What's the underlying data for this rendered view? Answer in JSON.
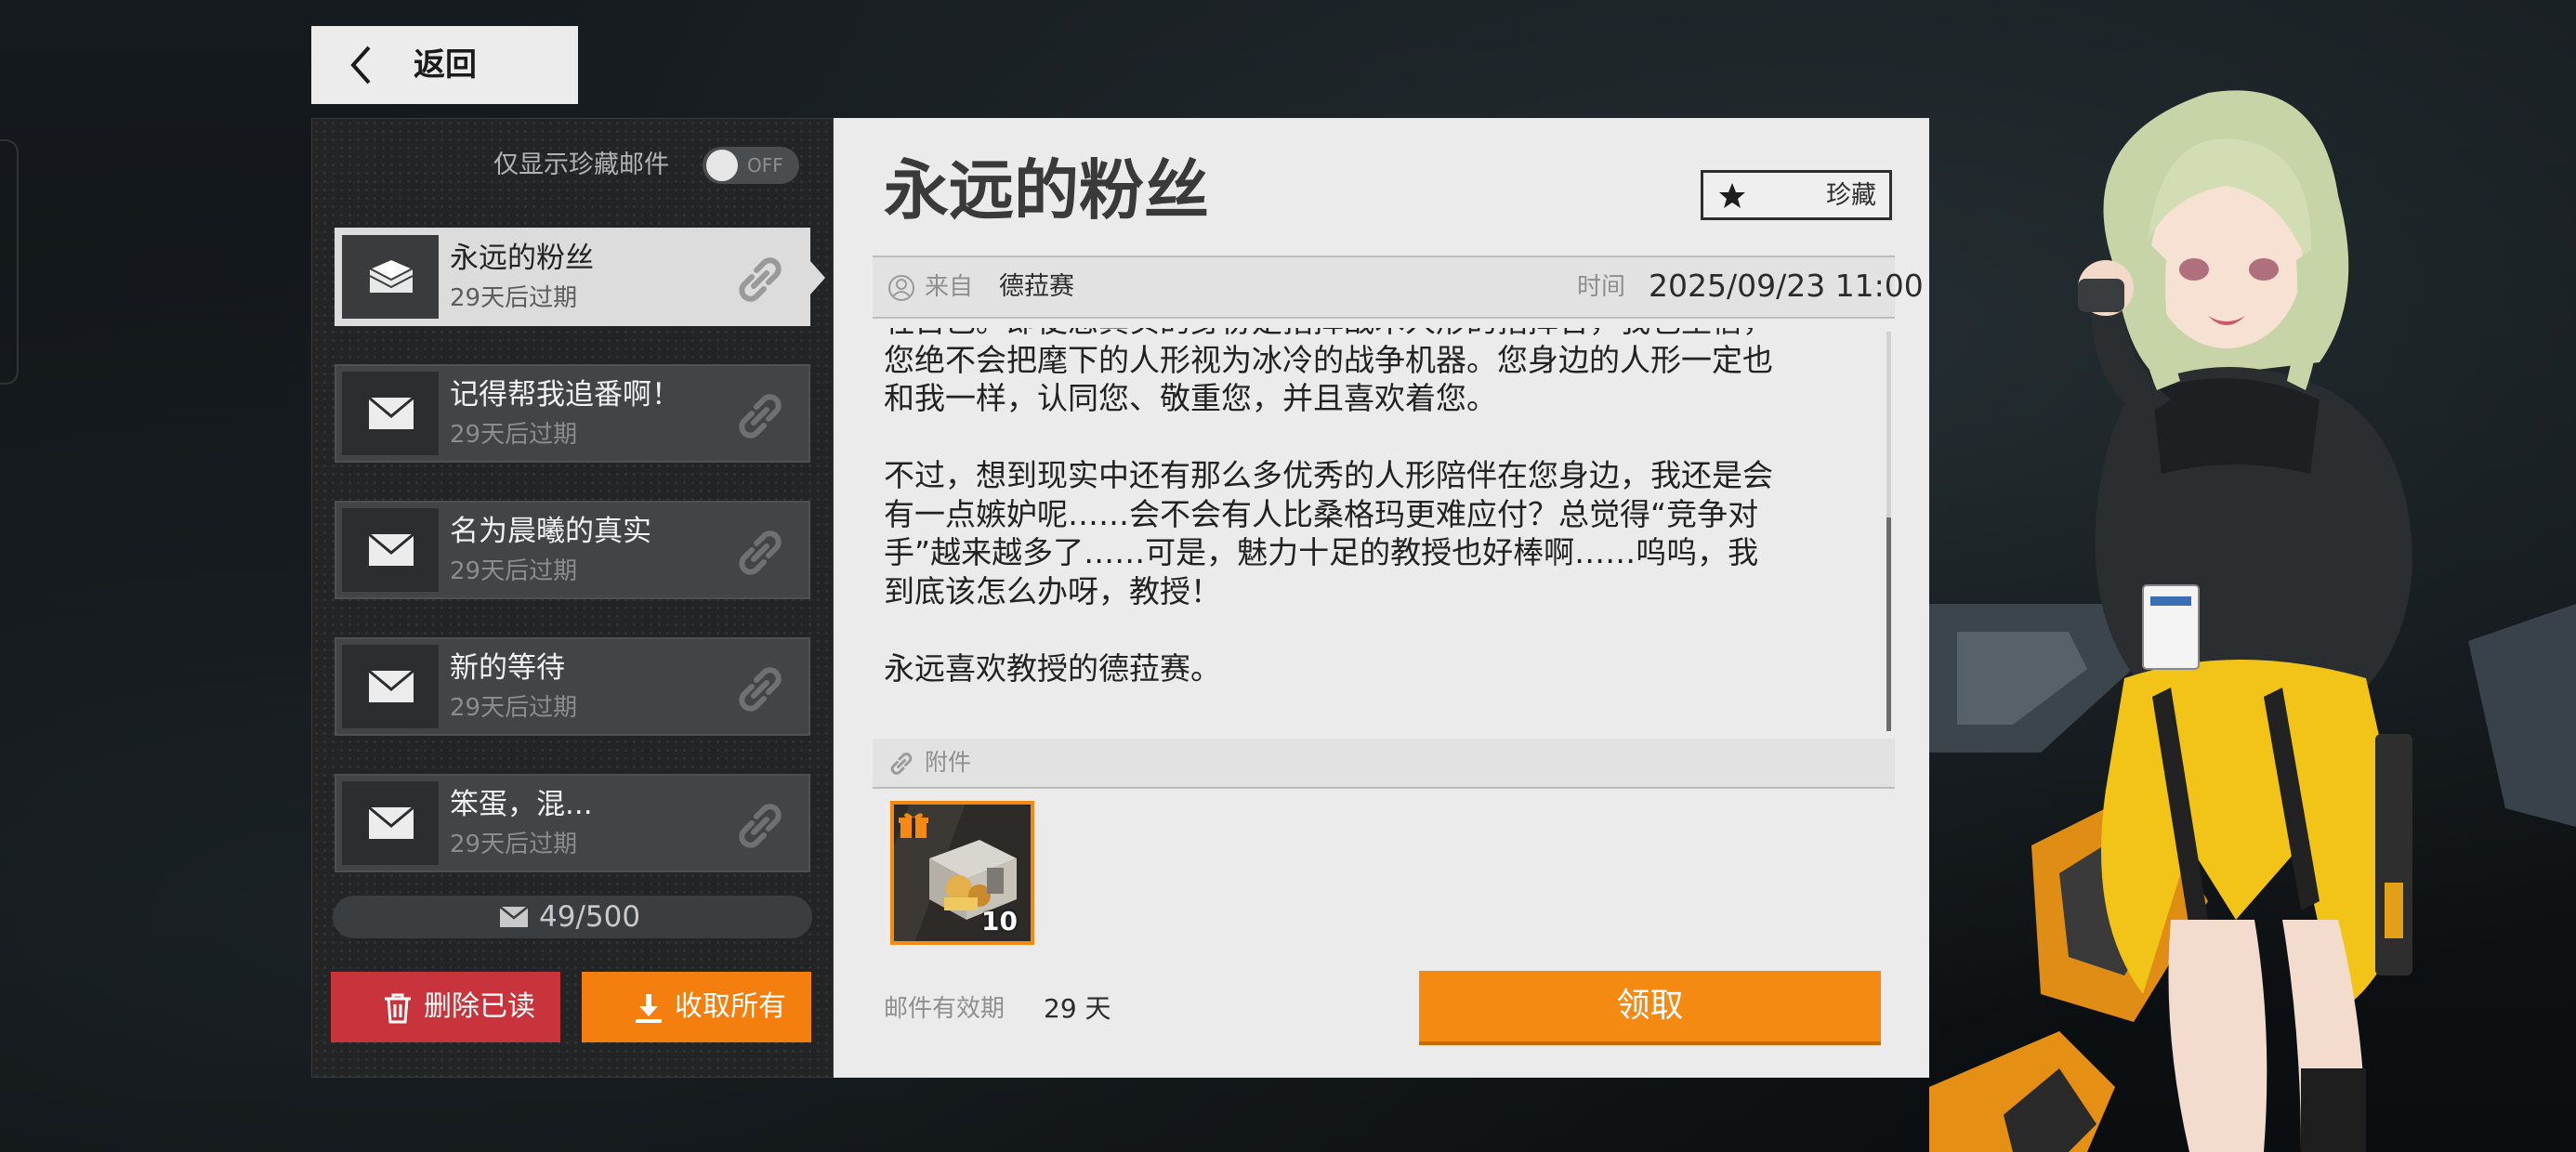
{
  "nav": {
    "back_label": "返回"
  },
  "sidebar": {
    "favorites_toggle_label": "仅显示珍藏邮件",
    "favorites_toggle_state": "OFF",
    "mails": [
      {
        "title": "永远的粉丝",
        "expiry": "29天后过期",
        "opened": true,
        "selected": true
      },
      {
        "title": "记得帮我追番啊！",
        "expiry": "29天后过期",
        "opened": false,
        "selected": false
      },
      {
        "title": "名为晨曦的真实",
        "expiry": "29天后过期",
        "opened": false,
        "selected": false
      },
      {
        "title": "新的等待",
        "expiry": "29天后过期",
        "opened": false,
        "selected": false
      },
      {
        "title": "笨蛋，混...",
        "expiry": "29天后过期",
        "opened": false,
        "selected": false
      }
    ],
    "mail_count": "49/500",
    "delete_read_label": "删除已读",
    "collect_all_label": "收取所有"
  },
  "mail": {
    "title": "永远的粉丝",
    "favorite_label": "珍藏",
    "from_label": "来自",
    "from_value": "德菈赛",
    "time_label": "时间",
    "time_value": "2025/09/23 11:00",
    "body": "牲自己。即便您真实的身份是指挥战术人形的指挥官，我也坚信，\n您绝不会把麾下的人形视为冰冷的战争机器。您身边的人形一定也\n和我一样，认同您、敬重您，并且喜欢着您。\n\n不过，想到现实中还有那么多优秀的人形陪伴在您身边，我还是会\n有一点嫉妒呢……会不会有人比桑格玛更难应付？总觉得“竞争对\n手”越来越多了……可是，魅力十足的教授也好棒啊……呜呜，我\n到底该怎么办呀，教授！\n\n永远喜欢教授的德菈赛。",
    "attachment_label": "附件",
    "attachment_qty": "10",
    "validity_label": "邮件有效期",
    "validity_value": "29 天",
    "claim_label": "领取"
  },
  "colors": {
    "accent_orange": "#f58a12",
    "delete_red": "#c9333b",
    "panel_dark": "#222425",
    "panel_light": "#ebebeb"
  }
}
